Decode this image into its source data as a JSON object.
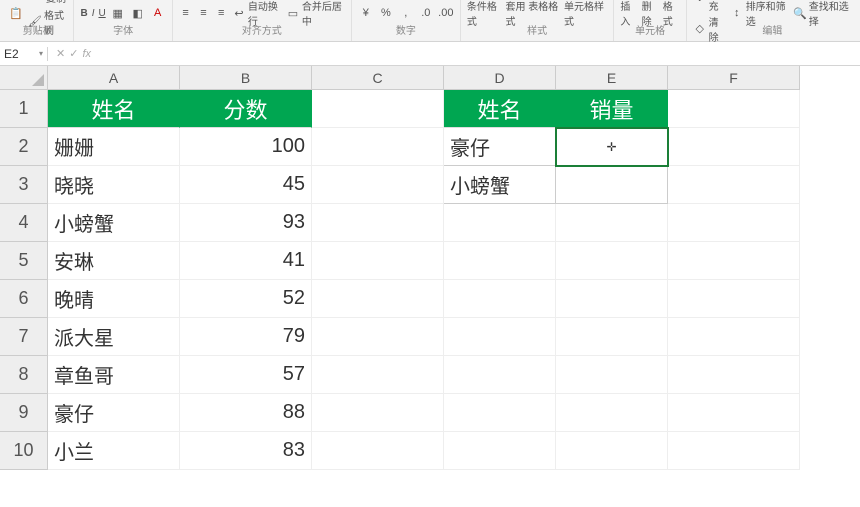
{
  "namebox": {
    "value": "E2"
  },
  "ribbon": {
    "clipboard": {
      "copy": "复制",
      "brush": "格式刷",
      "paste": "粘贴",
      "label": "剪贴板"
    },
    "font": {
      "b": "B",
      "i": "I",
      "u": "U",
      "label": "字体"
    },
    "align": {
      "wrap": "自动换行",
      "merge": "合并后居中",
      "label": "对齐方式"
    },
    "number": {
      "label": "数字"
    },
    "styles": {
      "cond": "条件格式",
      "table": "套用\n表格格式",
      "cell": "单元格样式",
      "label": "样式"
    },
    "cells": {
      "insert": "插入",
      "delete": "删除",
      "format": "格式",
      "label": "单元格"
    },
    "editing": {
      "fill": "填充",
      "clear": "清除",
      "sort": "排序和筛选",
      "find": "查找和选择",
      "label": "编辑"
    }
  },
  "columns": {
    "A": "A",
    "B": "B",
    "C": "C",
    "D": "D",
    "E": "E",
    "F": "F"
  },
  "table1": {
    "headers": {
      "name": "姓名",
      "score": "分数"
    },
    "rows": [
      {
        "name": "姗姗",
        "score": "100"
      },
      {
        "name": "晓晓",
        "score": "45"
      },
      {
        "name": "小螃蟹",
        "score": "93"
      },
      {
        "name": "安琳",
        "score": "41"
      },
      {
        "name": "晚晴",
        "score": "52"
      },
      {
        "name": "派大星",
        "score": "79"
      },
      {
        "name": "章鱼哥",
        "score": "57"
      },
      {
        "name": "豪仔",
        "score": "88"
      },
      {
        "name": "小兰",
        "score": "83"
      }
    ]
  },
  "table2": {
    "headers": {
      "name": "姓名",
      "sales": "销量"
    },
    "rows": [
      {
        "name": "豪仔",
        "sales": ""
      },
      {
        "name": "小螃蟹",
        "sales": ""
      }
    ]
  },
  "rownums": [
    "1",
    "2",
    "3",
    "4",
    "5",
    "6",
    "7",
    "8",
    "9",
    "10"
  ]
}
